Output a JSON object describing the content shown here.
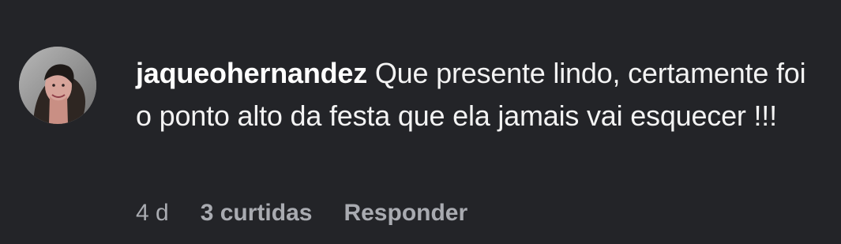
{
  "comment": {
    "username": "jaqueohernandez",
    "text": "Que presente lindo, certamente foi o ponto alto da festa que ela jamais vai esquecer !!!",
    "age": "4 d",
    "likes": "3 curtidas",
    "reply": "Responder"
  },
  "colors": {
    "background": "#232428",
    "text": "#f3f3f3",
    "meta": "#a9abb1"
  }
}
